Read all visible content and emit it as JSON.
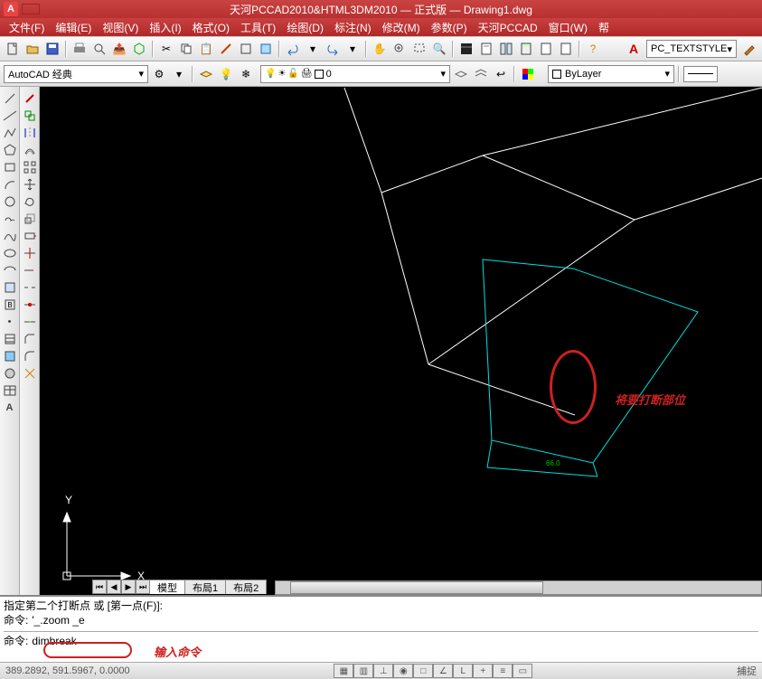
{
  "title": "天河PCCAD2010&HTML3DM2010 — 正式版 — Drawing1.dwg",
  "menu": {
    "file": "文件(F)",
    "edit": "编辑(E)",
    "view": "视图(V)",
    "insert": "插入(I)",
    "format": "格式(O)",
    "tools": "工具(T)",
    "draw": "绘图(D)",
    "dim": "标注(N)",
    "modify": "修改(M)",
    "param": "参数(P)",
    "pccad": "天河PCCAD",
    "window": "窗口(W)",
    "help": "帮"
  },
  "textstyle": {
    "label": "PC_TEXTSTYLE"
  },
  "workspace": {
    "label": "AutoCAD 经典"
  },
  "layer": {
    "name": "0"
  },
  "bylayer": {
    "label": "ByLayer"
  },
  "tabs": {
    "model": "模型",
    "layout1": "布局1",
    "layout2": "布局2"
  },
  "ucs": {
    "x": "X",
    "y": "Y"
  },
  "dim_label": "66.0",
  "annotation": {
    "break_location": "将要打断部位",
    "input_cmd": "输入命令"
  },
  "cmd": {
    "line1": "指定第二个打断点 或 [第一点(F)]:",
    "line2_prompt": "命令:",
    "line2_value": "'_.zoom _e",
    "line3_prompt": "命令:",
    "line3_value": "dimbreak"
  },
  "status": {
    "coords": "389.2892, 591.5967, 0.0000",
    "right": "捕捉"
  }
}
